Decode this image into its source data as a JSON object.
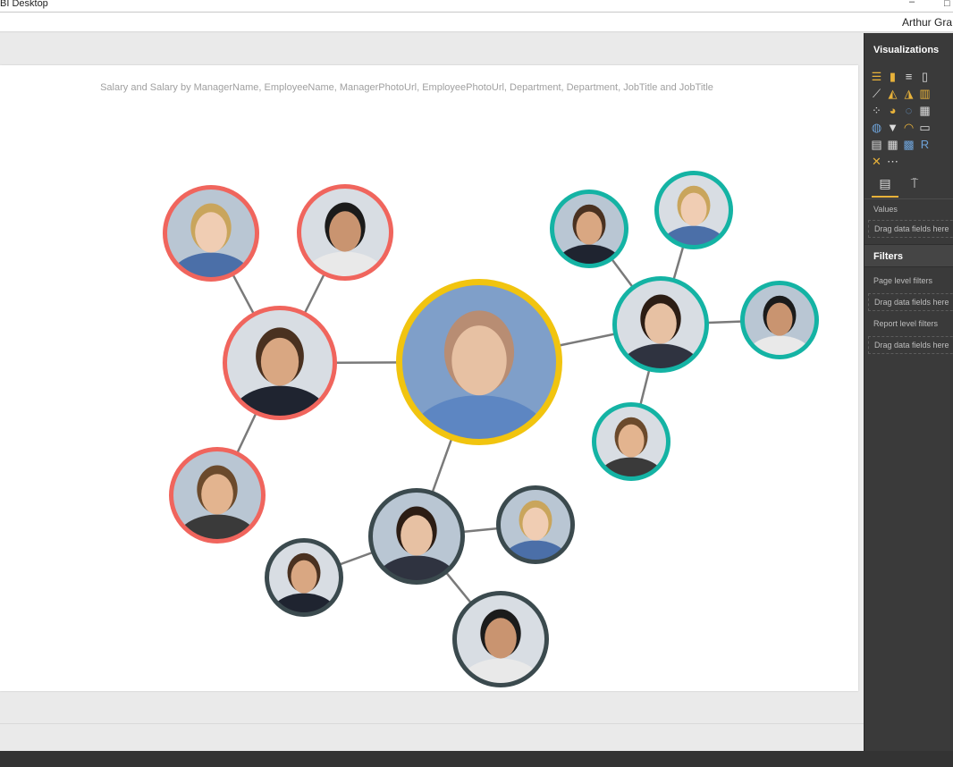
{
  "window": {
    "title": "BI Desktop",
    "minimize_label": "–",
    "maximize_label": "□"
  },
  "account": {
    "user_name": "Arthur Gra"
  },
  "visual": {
    "title": "Salary and Salary by ManagerName, EmployeeName, ManagerPhotoUrl, EmployeePhotoUrl, Department, Department, JobTitle and JobTitle"
  },
  "colors": {
    "root_ring": "#f1c40f",
    "red_group": "#f0655d",
    "teal_group": "#14b3a4",
    "dark_group": "#3b4a4e",
    "link": "#7a7a7a"
  },
  "network": {
    "nodes": [
      {
        "id": "root",
        "group": "root",
        "icon": "person-photo-icon"
      },
      {
        "id": "red-manager",
        "group": "red",
        "icon": "person-photo-icon"
      },
      {
        "id": "red-employee-1",
        "group": "red",
        "icon": "person-photo-icon"
      },
      {
        "id": "red-employee-2",
        "group": "red",
        "icon": "person-photo-icon"
      },
      {
        "id": "red-employee-3",
        "group": "red",
        "icon": "person-photo-icon"
      },
      {
        "id": "teal-manager",
        "group": "teal",
        "icon": "person-photo-icon"
      },
      {
        "id": "teal-employee-1",
        "group": "teal",
        "icon": "person-photo-icon"
      },
      {
        "id": "teal-employee-2",
        "group": "teal",
        "icon": "person-photo-icon"
      },
      {
        "id": "teal-employee-3",
        "group": "teal",
        "icon": "person-photo-icon"
      },
      {
        "id": "teal-employee-4",
        "group": "teal",
        "icon": "person-photo-icon"
      },
      {
        "id": "dark-manager",
        "group": "dark",
        "icon": "person-photo-icon"
      },
      {
        "id": "dark-employee-1",
        "group": "dark",
        "icon": "person-photo-icon"
      },
      {
        "id": "dark-employee-2",
        "group": "dark",
        "icon": "person-photo-icon"
      },
      {
        "id": "dark-employee-3",
        "group": "dark",
        "icon": "person-photo-icon"
      }
    ],
    "links": [
      [
        "root",
        "red-manager"
      ],
      [
        "root",
        "teal-manager"
      ],
      [
        "root",
        "dark-manager"
      ],
      [
        "red-manager",
        "red-employee-1"
      ],
      [
        "red-manager",
        "red-employee-2"
      ],
      [
        "red-manager",
        "red-employee-3"
      ],
      [
        "teal-manager",
        "teal-employee-1"
      ],
      [
        "teal-manager",
        "teal-employee-2"
      ],
      [
        "teal-manager",
        "teal-employee-3"
      ],
      [
        "teal-manager",
        "teal-employee-4"
      ],
      [
        "dark-manager",
        "dark-employee-1"
      ],
      [
        "dark-manager",
        "dark-employee-2"
      ],
      [
        "dark-manager",
        "dark-employee-3"
      ]
    ]
  },
  "visualizations_pane": {
    "header": "Visualizations",
    "icons": [
      "stacked-bar-chart-icon",
      "stacked-column-chart-icon",
      "clustered-bar-chart-icon",
      "clustered-column-chart-icon",
      "line-chart-icon",
      "area-chart-icon",
      "stacked-area-chart-icon",
      "ribbon-chart-icon",
      "scatter-chart-icon",
      "pie-chart-icon",
      "donut-chart-icon",
      "treemap-icon",
      "map-icon",
      "funnel-icon",
      "gauge-icon",
      "card-icon",
      "slicer-icon",
      "table-icon",
      "matrix-icon",
      "r-visual-icon",
      "custom-visual-icon",
      "more-visuals-icon"
    ],
    "fields_tab_icon": "fields-icon",
    "format_tab_icon": "paint-roller-icon",
    "values_label": "Values",
    "values_dropzone": "Drag data fields here"
  },
  "filters_pane": {
    "header": "Filters",
    "page_level_label": "Page level filters",
    "page_level_dropzone": "Drag data fields here",
    "report_level_label": "Report level filters",
    "report_level_dropzone": "Drag data fields here"
  }
}
